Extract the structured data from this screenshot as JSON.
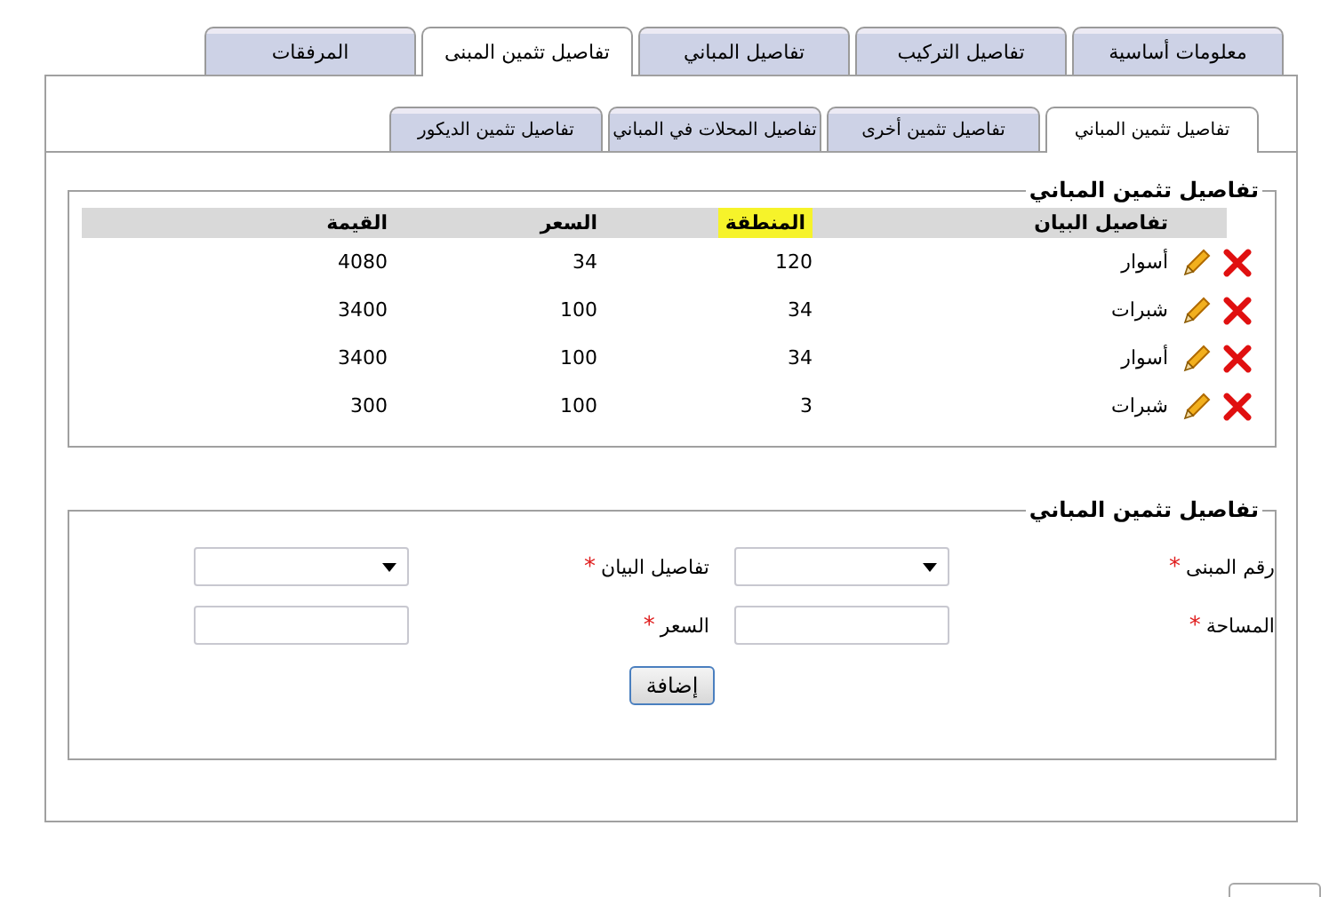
{
  "tabs": [
    {
      "label": "معلومات أساسية",
      "selected": false
    },
    {
      "label": "تفاصيل التركيب",
      "selected": false
    },
    {
      "label": "تفاصيل المباني",
      "selected": false
    },
    {
      "label": "تفاصيل تثمين المبنى",
      "selected": true
    },
    {
      "label": "المرفقات",
      "selected": false
    }
  ],
  "sub_tabs": [
    {
      "label": "تفاصيل تثمين المباني",
      "selected": true
    },
    {
      "label": "تفاصيل تثمين أخرى",
      "selected": false
    },
    {
      "label": "تفاصيل المحلات في المباني",
      "selected": false
    },
    {
      "label": "تفاصيل تثمين الديكور",
      "selected": false
    }
  ],
  "table": {
    "legend": "تفاصيل تثمين المباني",
    "columns": [
      {
        "label": "تفاصيل البيان",
        "highlighted": false
      },
      {
        "label": "المنطقة",
        "highlighted": true
      },
      {
        "label": "السعر",
        "highlighted": false
      },
      {
        "label": "القيمة",
        "highlighted": false
      }
    ],
    "rows": [
      {
        "cells": [
          "أسوار",
          "120",
          "34",
          "4080"
        ]
      },
      {
        "cells": [
          "شبرات",
          "34",
          "100",
          "3400"
        ]
      },
      {
        "cells": [
          "أسوار",
          "34",
          "100",
          "3400"
        ]
      },
      {
        "cells": [
          "شبرات",
          "3",
          "100",
          "300"
        ]
      }
    ]
  },
  "form": {
    "legend": "تفاصيل تثمين المباني",
    "fields": [
      {
        "label": "رقم المبنى",
        "mark": "*",
        "kind": "select"
      },
      {
        "label": "تفاصيل البيان",
        "mark": "*",
        "kind": "select"
      },
      {
        "label": "المساحة",
        "mark": "*",
        "kind": "text"
      },
      {
        "label": "السعر",
        "mark": "*",
        "kind": "text"
      }
    ],
    "submit": "إضافة"
  }
}
